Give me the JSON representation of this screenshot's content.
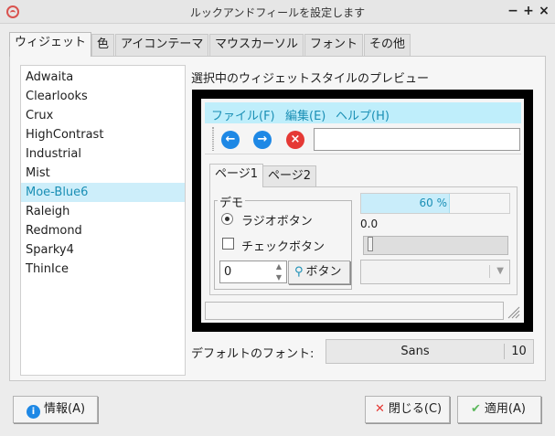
{
  "window": {
    "title": "ルックアンドフィールを設定します",
    "minimize": "−",
    "maximize": "+",
    "close": "×"
  },
  "tabs": [
    {
      "label": "ウィジェット"
    },
    {
      "label": "色"
    },
    {
      "label": "アイコンテーマ"
    },
    {
      "label": "マウスカーソル"
    },
    {
      "label": "フォント"
    },
    {
      "label": "その他"
    }
  ],
  "themes": [
    "Adwaita",
    "Clearlooks",
    "Crux",
    "HighContrast",
    "Industrial",
    "Mist",
    "Moe-Blue6",
    "Raleigh",
    "Redmond",
    "Sparky4",
    "ThinIce"
  ],
  "selected_theme": "Moe-Blue6",
  "preview": {
    "title": "選択中のウィジェットスタイルのプレビュー",
    "menu": [
      "ファイル(F)",
      "編集(E)",
      "ヘルプ(H)"
    ],
    "toolbar_icons": [
      "back-icon",
      "forward-icon",
      "stop-icon"
    ],
    "pages": [
      "ページ1",
      "ページ2"
    ],
    "demo_label": "デモ",
    "radio_label": "ラジオボタン",
    "check_label": "チェックボタン",
    "spin_value": "0",
    "button_label": "ボタン",
    "progress_text": "60 %",
    "progress_fraction": 0.6,
    "scale_value": "0.0"
  },
  "font": {
    "label": "デフォルトのフォント:",
    "name": "Sans",
    "size": "10"
  },
  "buttons": {
    "about": "情報(A)",
    "close": "閉じる(C)",
    "apply": "適用(A)"
  },
  "colors": {
    "accent": "#1a8fb5",
    "selection": "#cdeefa",
    "menubar": "#bfeefb",
    "toolbar_blue": "#1e88e5",
    "toolbar_red": "#e53935",
    "apply_green": "#5cb85c"
  }
}
